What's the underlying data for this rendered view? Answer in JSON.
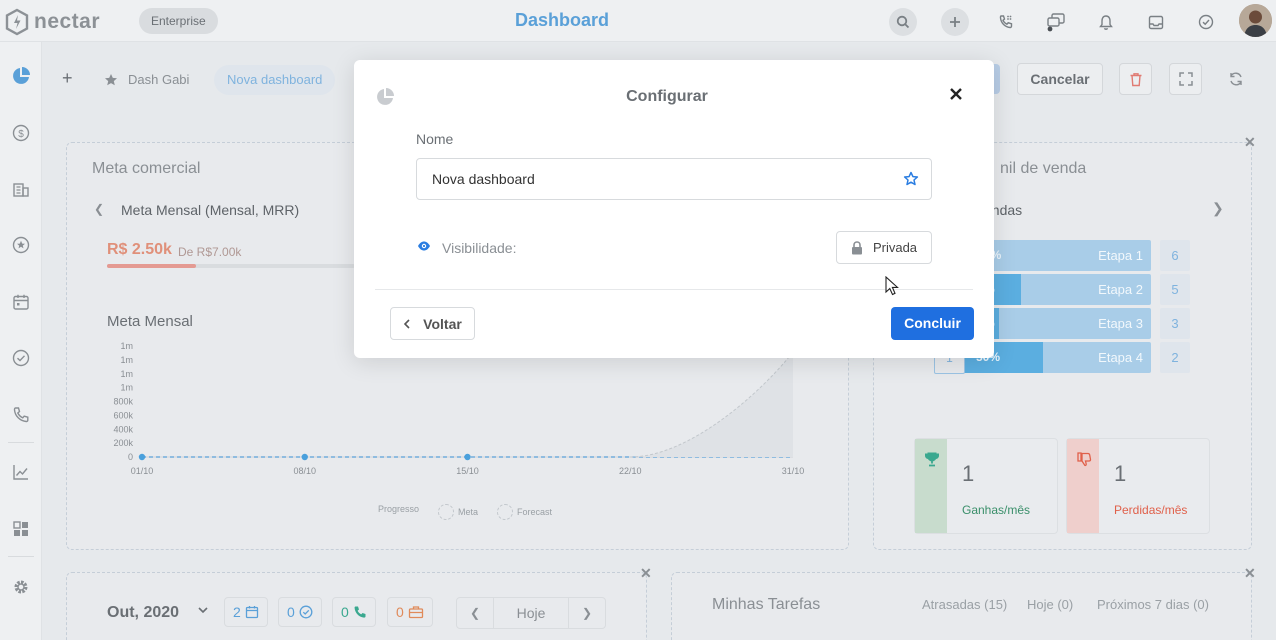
{
  "app": {
    "brand": "nectar",
    "plan": "Enterprise",
    "page_title": "Dashboard"
  },
  "tabs": {
    "favorite": "Dash Gabi",
    "active": "Nova dashboard"
  },
  "toolbar": {
    "cancel": "Cancelar"
  },
  "meta_widget": {
    "title": "Meta comercial",
    "selector": "Meta Mensal (Mensal, MRR)",
    "value": "R$ 2.50k",
    "of_label": "De R$7.00k",
    "progress": 0.357,
    "chart_title": "Meta Mensal"
  },
  "chart_data": {
    "type": "line",
    "title": "Meta Mensal",
    "x": [
      "01/10",
      "08/10",
      "15/10",
      "22/10",
      "31/10"
    ],
    "yticks": [
      "0",
      "200k",
      "400k",
      "600k",
      "800k",
      "1m",
      "1m",
      "1m",
      "1m"
    ],
    "series": [
      {
        "name": "Progresso",
        "values": [
          0,
          0,
          0,
          null,
          null
        ]
      },
      {
        "name": "Forecast",
        "values": [
          null,
          null,
          null,
          0,
          1000000
        ]
      }
    ],
    "legend": [
      "Progresso",
      "Meta",
      "Forecast"
    ],
    "legend_position": "bottom"
  },
  "funnel_widget": {
    "title_visible": "nil de venda",
    "subtitle_visible": "endas",
    "stages": [
      {
        "pct": "0%",
        "name": "Etapa 1",
        "count": "6",
        "fill": 0.05
      },
      {
        "pct": "%",
        "name": "Etapa 2",
        "count": "5",
        "fill": 0.4
      },
      {
        "pct": "%",
        "name": "Etapa 3",
        "count": "3",
        "fill": 0.3
      },
      {
        "pct": "50%",
        "name": "Etapa 4",
        "count": "2",
        "fill": 0.5
      }
    ],
    "stage4_box": "1",
    "won": {
      "count": "1",
      "label": "Ganhas/mês"
    },
    "lost": {
      "count": "1",
      "label": "Perdidas/mês"
    }
  },
  "calendar_widget": {
    "month": "Out, 2020",
    "chips": [
      {
        "count": "2",
        "icon": "calendar-icon",
        "color": "#5aa0d8"
      },
      {
        "count": "0",
        "icon": "check-circle-icon",
        "color": "#5aa0d8"
      },
      {
        "count": "0",
        "icon": "phone-icon",
        "color": "#3aa88f"
      },
      {
        "count": "0",
        "icon": "briefcase-icon",
        "color": "#e08a5a"
      }
    ],
    "today": "Hoje"
  },
  "tasks_widget": {
    "title": "Minhas Tarefas",
    "filters": [
      "Atrasadas (15)",
      "Hoje (0)",
      "Próximos 7 dias (0)"
    ]
  },
  "modal": {
    "title": "Configurar",
    "name_label": "Nome",
    "name_value": "Nova dashboard",
    "visibility_label": "Visibilidade:",
    "privacy_value": "Privada",
    "back": "Voltar",
    "done": "Concluir"
  },
  "colors": {
    "accent": "#1f6fe0",
    "brand_blue": "#5aa0d8",
    "won_green": "#3aa88f",
    "lost_red": "#e0604a"
  }
}
